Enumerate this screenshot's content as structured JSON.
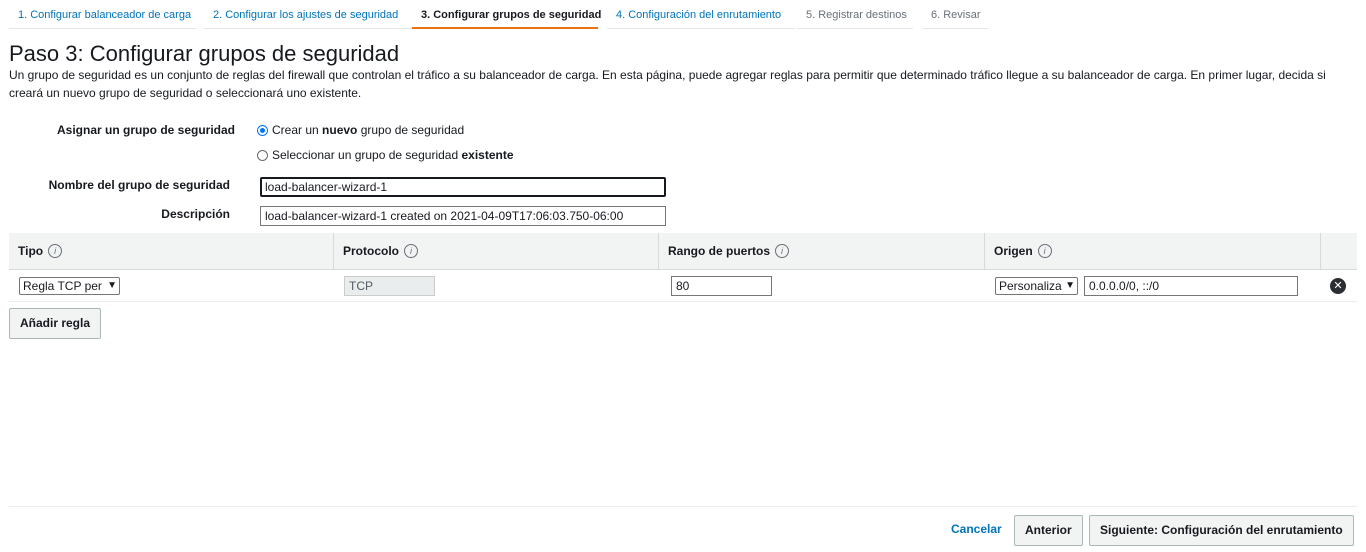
{
  "wizard": {
    "steps": [
      {
        "label": "1. Configurar balanceador de carga"
      },
      {
        "label": "2. Configurar los ajustes de seguridad"
      },
      {
        "label": "3. Configurar grupos de seguridad"
      },
      {
        "label": "4. Configuración del enrutamiento"
      },
      {
        "label": "5. Registrar destinos"
      },
      {
        "label": "6. Revisar"
      }
    ],
    "active_step": 3
  },
  "page": {
    "title": "Paso 3: Configurar grupos de seguridad",
    "intro": "Un grupo de seguridad es un conjunto de reglas del firewall que controlan el tráfico a su balanceador de carga. En esta página, puede agregar reglas para permitir que determinado tráfico llegue a su balanceador de carga. En primer lugar, decida si creará un nuevo grupo de seguridad o seleccionará uno existente."
  },
  "form": {
    "assign_label": "Asignar un grupo de seguridad",
    "option_new": {
      "before": "Crear un ",
      "bold": "nuevo",
      "after": " grupo de seguridad",
      "checked": true
    },
    "option_existing": {
      "before": "Seleccionar un grupo de seguridad ",
      "bold": "existente",
      "checked": false
    },
    "name_label": "Nombre del grupo de seguridad",
    "name_value": "load-balancer-wizard-1",
    "description_label": "Descripción",
    "description_value": "load-balancer-wizard-1 created on 2021-04-09T17:06:03.750-06:00"
  },
  "rules_table": {
    "headers": [
      "Tipo",
      "Protocolo",
      "Rango de puertos",
      "Origen"
    ],
    "info_icon_glyph": "i",
    "rows": [
      {
        "type": "Regla TCP per",
        "protocol": "TCP",
        "port_range": "80",
        "source_type": "Personaliza",
        "source_value": "0.0.0.0/0, ::/0"
      }
    ],
    "add_rule_label": "Añadir regla"
  },
  "footer": {
    "cancel_label": "Cancelar",
    "previous_label": "Anterior",
    "next_label": "Siguiente: Configuración del enrutamiento"
  },
  "colors": {
    "link": "#0073bb",
    "active_tab_underline": "#ec7211",
    "header_bg": "#f2f3f3"
  },
  "icons": {
    "info": "info-icon",
    "remove": "remove-rule-icon",
    "dropdown": "chevron-down-icon"
  }
}
